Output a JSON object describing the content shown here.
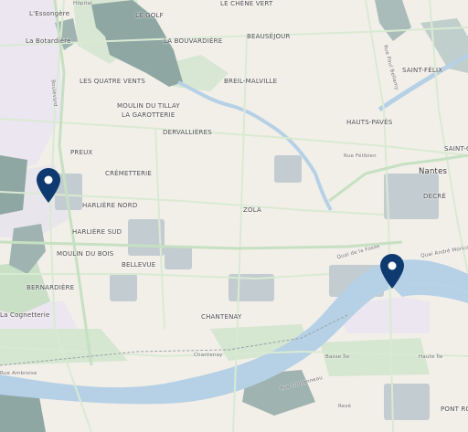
{
  "map": {
    "colors": {
      "land": "#f2efe9",
      "water": "#b6d1e6",
      "park": "#c9dfc6",
      "woods": "#8fa7a3",
      "building": "#c3ccd1",
      "road": "#d9ead3",
      "road_major": "#c6e0c2",
      "residential": "#ece6f0",
      "marker": "#0e3a70"
    },
    "districts": {
      "lessongere": "L'Essongère",
      "hopital": "Hôpital",
      "le_golf": "LE GOLF",
      "le_chene_vert": "LE CHÊNE VERT",
      "la_botardiere": "La Botardière",
      "la_bouvardiere": "LA BOUVARDIÈRE",
      "beausejour": "BEAUSÉJOUR",
      "saint_felix": "SAINT-FÉLIX",
      "les_quatre_vents": "LES QUATRE VENTS",
      "breil_malville": "BREIL-MALVILLE",
      "moulin_du_tillay": "MOULIN DU TILLAY",
      "la_garotterie": "LA GAROTTERIE",
      "hauts_paves": "HAUTS-PAVÉS",
      "dervallieres": "DERVALLIÈRES",
      "saint_cl": "SAINT-CL",
      "preux": "PREUX",
      "cremetterie": "CRÉMETTERIE",
      "nantes": "Nantes",
      "decre": "DECRÉ",
      "harliere_nord": "HARLIÈRE NORD",
      "zola": "ZOLA",
      "harliere_sud": "HARLIÈRE SUD",
      "moulin_du_bois": "MOULIN DU BOIS",
      "bellevue": "BELLEVUE",
      "bernardiere": "BERNARDIÈRE",
      "la_cognetterie": "La Cognetterie",
      "chantenay": "CHANTENAY",
      "basse_ile": "Basse Île",
      "haute_ile": "Haute Île",
      "rezé": "Rezé",
      "pont_rousseau": "PONT ROUSSEAU"
    },
    "streets": {
      "rue_felibien": "Rue Félibien",
      "quai_andre_morice": "Quai André Morice",
      "quai_de_la_fosse": "Quai de la Fosse",
      "chantenay_station": "Chantenay",
      "rue_ambroise": "Rue Ambroise",
      "rue_paul_bellamy": "Rue Paul Bellamy",
      "boulevard": "Boulevard",
      "rue_ordronneau": "Rue Ordronneau"
    },
    "markers": [
      {
        "id": "marker-1",
        "icon": "map-pin-icon"
      },
      {
        "id": "marker-2",
        "icon": "map-pin-icon"
      }
    ]
  }
}
